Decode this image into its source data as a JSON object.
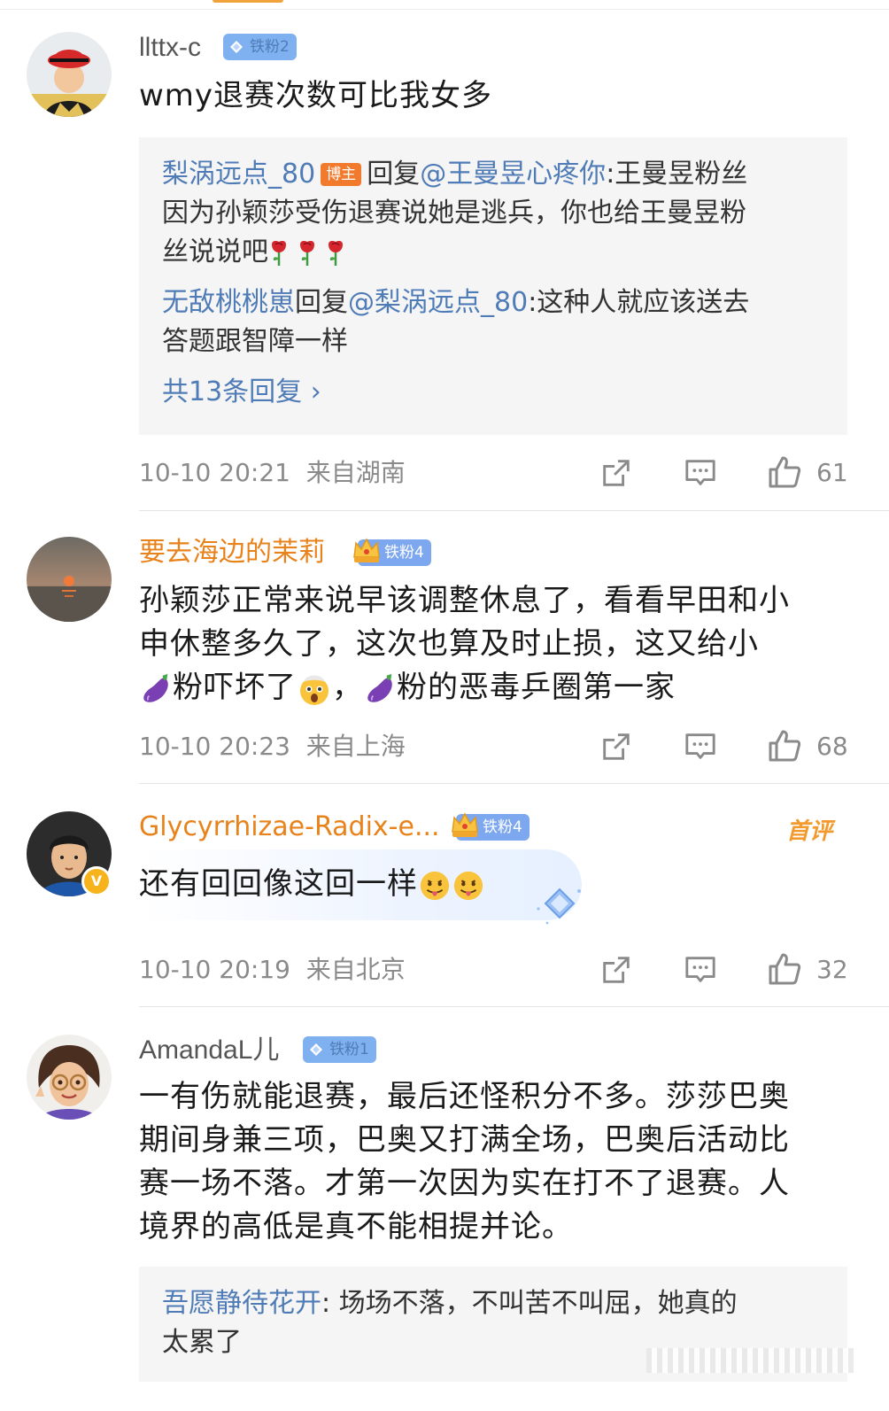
{
  "comments": [
    {
      "username": "llttx-c",
      "badge": "铁粉2",
      "text": "wmy退赛次数可比我女多",
      "replies": {
        "r1_user": "梨涡远点_80",
        "r1_tag": "博主",
        "r1_mid": "回复",
        "r1_mention": "@王曼昱心疼你",
        "r1_line1": ":王曼昱粉丝",
        "r1_line2": "因为孙颖莎受伤退赛说她是逃兵，你也给王曼昱粉",
        "r1_line3": "丝说说吧",
        "r2_user": "无敌桃桃崽",
        "r2_mid": "回复",
        "r2_mention": "@梨涡远点_80",
        "r2_line1": ":这种人就应该送去",
        "r2_line2": "答题跟智障一样",
        "more": "共13条回复 ›"
      },
      "time": "10-10 20:21",
      "location": "来自湖南",
      "likes": "61"
    },
    {
      "username": "要去海边的茉莉",
      "badge": "铁粉4",
      "line1": "孙颖莎正常来说早该调整休息了，看看早田和小",
      "line2": "申休整多久了，这次也算及时止损，这又给小",
      "line3a": "粉吓坏了",
      "line3b": "，",
      "line3c": "粉的恶毒乒圈第一家",
      "time": "10-10 20:23",
      "location": "来自上海",
      "likes": "68"
    },
    {
      "username": "Glycyrrhizae-Radix-e...",
      "badge": "铁粉4",
      "tag": "首评",
      "text": "还有回回像这回一样",
      "time": "10-10 20:19",
      "location": "来自北京",
      "likes": "32"
    },
    {
      "username": "AmandaL儿",
      "badge": "铁粉1",
      "line1": "一有伤就能退赛，最后还怪积分不多。莎莎巴奥",
      "line2": "期间身兼三项，巴奥又打满全场，巴奥后活动比",
      "line3": "赛一场不落。才第一次因为实在打不了退赛。人",
      "line4": "境界的高低是真不能相提并论。",
      "reply_user": "吾愿静待花开",
      "reply_line1": ": 场场不落，不叫苦不叫屈，她真的",
      "reply_line2": "太累了"
    }
  ],
  "icons": [
    "share-icon",
    "comment-icon",
    "like-icon",
    "gem-icon",
    "crown-icon",
    "rose-emoji",
    "eggplant-emoji",
    "shocked-emoji",
    "tongue-emoji"
  ],
  "colors": {
    "link_blue": "#4f7cb6",
    "orange_name": "#e8821b",
    "meta_gray": "#8a8a8a",
    "badge_blue": "#7fb1f0"
  }
}
